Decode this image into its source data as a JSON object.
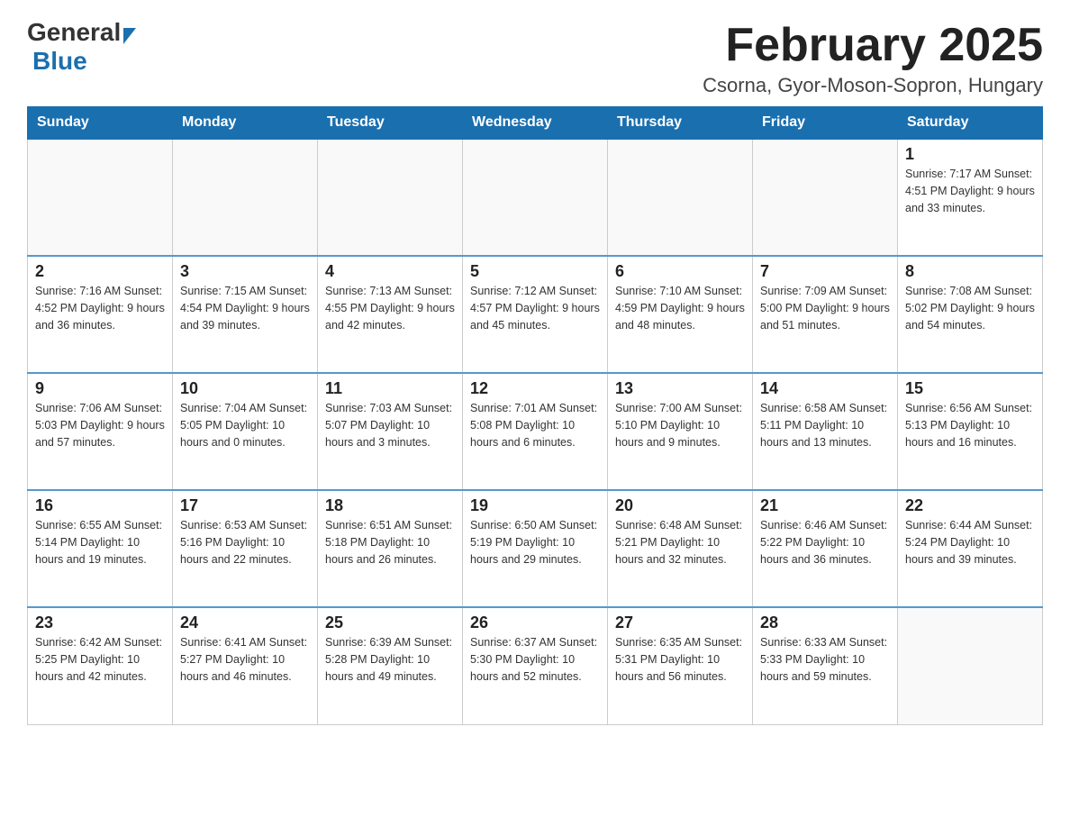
{
  "header": {
    "title": "February 2025",
    "location": "Csorna, Gyor-Moson-Sopron, Hungary",
    "logo_general": "General",
    "logo_blue": "Blue"
  },
  "days_of_week": [
    "Sunday",
    "Monday",
    "Tuesday",
    "Wednesday",
    "Thursday",
    "Friday",
    "Saturday"
  ],
  "weeks": [
    {
      "days": [
        {
          "number": "",
          "info": ""
        },
        {
          "number": "",
          "info": ""
        },
        {
          "number": "",
          "info": ""
        },
        {
          "number": "",
          "info": ""
        },
        {
          "number": "",
          "info": ""
        },
        {
          "number": "",
          "info": ""
        },
        {
          "number": "1",
          "info": "Sunrise: 7:17 AM\nSunset: 4:51 PM\nDaylight: 9 hours\nand 33 minutes."
        }
      ]
    },
    {
      "days": [
        {
          "number": "2",
          "info": "Sunrise: 7:16 AM\nSunset: 4:52 PM\nDaylight: 9 hours\nand 36 minutes."
        },
        {
          "number": "3",
          "info": "Sunrise: 7:15 AM\nSunset: 4:54 PM\nDaylight: 9 hours\nand 39 minutes."
        },
        {
          "number": "4",
          "info": "Sunrise: 7:13 AM\nSunset: 4:55 PM\nDaylight: 9 hours\nand 42 minutes."
        },
        {
          "number": "5",
          "info": "Sunrise: 7:12 AM\nSunset: 4:57 PM\nDaylight: 9 hours\nand 45 minutes."
        },
        {
          "number": "6",
          "info": "Sunrise: 7:10 AM\nSunset: 4:59 PM\nDaylight: 9 hours\nand 48 minutes."
        },
        {
          "number": "7",
          "info": "Sunrise: 7:09 AM\nSunset: 5:00 PM\nDaylight: 9 hours\nand 51 minutes."
        },
        {
          "number": "8",
          "info": "Sunrise: 7:08 AM\nSunset: 5:02 PM\nDaylight: 9 hours\nand 54 minutes."
        }
      ]
    },
    {
      "days": [
        {
          "number": "9",
          "info": "Sunrise: 7:06 AM\nSunset: 5:03 PM\nDaylight: 9 hours\nand 57 minutes."
        },
        {
          "number": "10",
          "info": "Sunrise: 7:04 AM\nSunset: 5:05 PM\nDaylight: 10 hours\nand 0 minutes."
        },
        {
          "number": "11",
          "info": "Sunrise: 7:03 AM\nSunset: 5:07 PM\nDaylight: 10 hours\nand 3 minutes."
        },
        {
          "number": "12",
          "info": "Sunrise: 7:01 AM\nSunset: 5:08 PM\nDaylight: 10 hours\nand 6 minutes."
        },
        {
          "number": "13",
          "info": "Sunrise: 7:00 AM\nSunset: 5:10 PM\nDaylight: 10 hours\nand 9 minutes."
        },
        {
          "number": "14",
          "info": "Sunrise: 6:58 AM\nSunset: 5:11 PM\nDaylight: 10 hours\nand 13 minutes."
        },
        {
          "number": "15",
          "info": "Sunrise: 6:56 AM\nSunset: 5:13 PM\nDaylight: 10 hours\nand 16 minutes."
        }
      ]
    },
    {
      "days": [
        {
          "number": "16",
          "info": "Sunrise: 6:55 AM\nSunset: 5:14 PM\nDaylight: 10 hours\nand 19 minutes."
        },
        {
          "number": "17",
          "info": "Sunrise: 6:53 AM\nSunset: 5:16 PM\nDaylight: 10 hours\nand 22 minutes."
        },
        {
          "number": "18",
          "info": "Sunrise: 6:51 AM\nSunset: 5:18 PM\nDaylight: 10 hours\nand 26 minutes."
        },
        {
          "number": "19",
          "info": "Sunrise: 6:50 AM\nSunset: 5:19 PM\nDaylight: 10 hours\nand 29 minutes."
        },
        {
          "number": "20",
          "info": "Sunrise: 6:48 AM\nSunset: 5:21 PM\nDaylight: 10 hours\nand 32 minutes."
        },
        {
          "number": "21",
          "info": "Sunrise: 6:46 AM\nSunset: 5:22 PM\nDaylight: 10 hours\nand 36 minutes."
        },
        {
          "number": "22",
          "info": "Sunrise: 6:44 AM\nSunset: 5:24 PM\nDaylight: 10 hours\nand 39 minutes."
        }
      ]
    },
    {
      "days": [
        {
          "number": "23",
          "info": "Sunrise: 6:42 AM\nSunset: 5:25 PM\nDaylight: 10 hours\nand 42 minutes."
        },
        {
          "number": "24",
          "info": "Sunrise: 6:41 AM\nSunset: 5:27 PM\nDaylight: 10 hours\nand 46 minutes."
        },
        {
          "number": "25",
          "info": "Sunrise: 6:39 AM\nSunset: 5:28 PM\nDaylight: 10 hours\nand 49 minutes."
        },
        {
          "number": "26",
          "info": "Sunrise: 6:37 AM\nSunset: 5:30 PM\nDaylight: 10 hours\nand 52 minutes."
        },
        {
          "number": "27",
          "info": "Sunrise: 6:35 AM\nSunset: 5:31 PM\nDaylight: 10 hours\nand 56 minutes."
        },
        {
          "number": "28",
          "info": "Sunrise: 6:33 AM\nSunset: 5:33 PM\nDaylight: 10 hours\nand 59 minutes."
        },
        {
          "number": "",
          "info": ""
        }
      ]
    }
  ]
}
